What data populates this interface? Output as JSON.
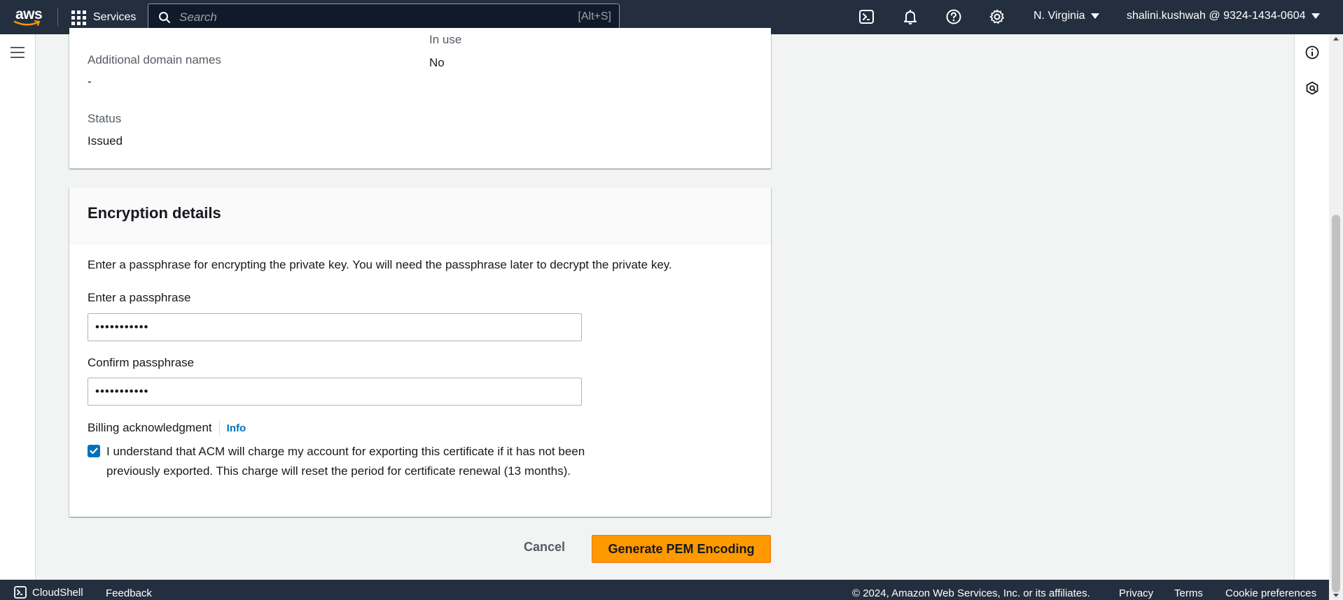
{
  "topnav": {
    "logo_text": "aws",
    "services_label": "Services",
    "search_placeholder": "Search",
    "search_shortcut": "[Alt+S]",
    "region": "N. Virginia",
    "account": "shalini.kushwah @ 9324-1434-0604",
    "icons": [
      "cloudshell-icon",
      "bell-icon",
      "help-icon",
      "settings-icon"
    ]
  },
  "details": {
    "in_use_label": "In use",
    "in_use_value": "No",
    "additional_domains_label": "Additional domain names",
    "additional_domains_value": "-",
    "status_label": "Status",
    "status_value": "Issued"
  },
  "encryption": {
    "title": "Encryption details",
    "description": "Enter a passphrase for encrypting the private key. You will need the passphrase later to decrypt the private key.",
    "passphrase_label": "Enter a passphrase",
    "passphrase_value": "•••••••••••",
    "confirm_label": "Confirm passphrase",
    "confirm_value": "•••••••••••",
    "billing_label": "Billing acknowledgment",
    "info_link": "Info",
    "ack_checked": true,
    "ack_text": "I understand that ACM will charge my account for exporting this certificate if it has not been previously exported. This charge will reset the period for certificate renewal (13 months)."
  },
  "actions": {
    "cancel": "Cancel",
    "generate": "Generate PEM Encoding"
  },
  "footer": {
    "cloudshell": "CloudShell",
    "feedback": "Feedback",
    "copyright": "© 2024, Amazon Web Services, Inc. or its affiliates.",
    "privacy": "Privacy",
    "terms": "Terms",
    "cookie": "Cookie preferences"
  },
  "colors": {
    "nav_bg": "#232f3e",
    "primary_button": "#ff9900",
    "link": "#0073bb",
    "page_bg": "#f2f3f3"
  }
}
